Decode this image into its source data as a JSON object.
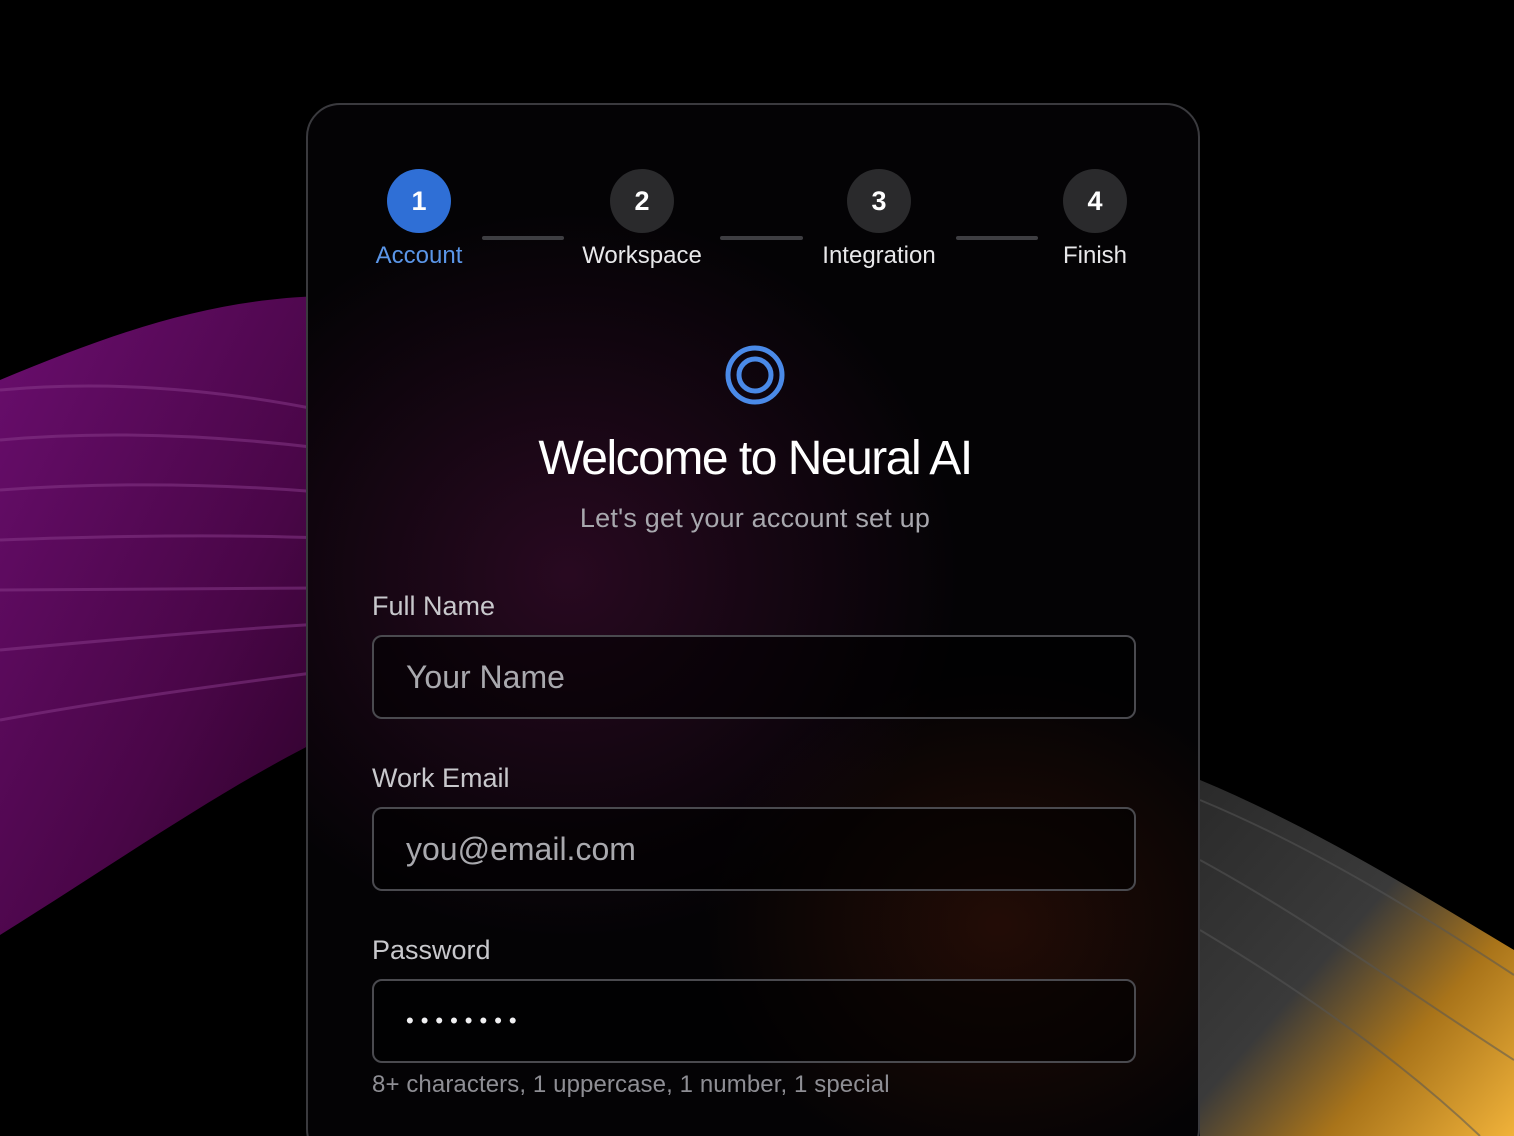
{
  "stepper": {
    "steps": [
      {
        "number": "1",
        "label": "Account",
        "state": "active"
      },
      {
        "number": "2",
        "label": "Workspace",
        "state": "pending"
      },
      {
        "number": "3",
        "label": "Integration",
        "state": "pending"
      },
      {
        "number": "4",
        "label": "Finish",
        "state": "pending"
      }
    ]
  },
  "header": {
    "logo_icon": "concentric-ring-icon",
    "title": "Welcome to Neural AI",
    "subtitle": "Let's get your account set up"
  },
  "form": {
    "full_name": {
      "label": "Full Name",
      "placeholder": "Your Name",
      "value": ""
    },
    "work_email": {
      "label": "Work Email",
      "placeholder": "you@email.com",
      "value": ""
    },
    "password": {
      "label": "Password",
      "masked_value": "••••••••",
      "hint": "8+ characters, 1 uppercase, 1 number, 1 special"
    }
  },
  "colors": {
    "accent": "#2f6fd6",
    "accent_label": "#5b96e8",
    "page_background": "#000000",
    "card_border": "#3a3a3e"
  }
}
